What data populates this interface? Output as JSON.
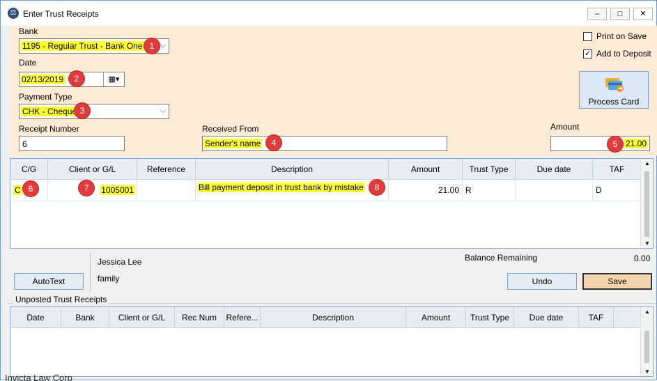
{
  "window": {
    "title": "Enter Trust Receipts",
    "minimize": "–",
    "maximize": "□",
    "close": "✕"
  },
  "bank": {
    "label": "Bank",
    "value": "1195 - Regular Trust - Bank One"
  },
  "date": {
    "label": "Date",
    "value": "02/13/2019"
  },
  "payment_type": {
    "label": "Payment Type",
    "value": "CHK - Cheque"
  },
  "receipt_number": {
    "label": "Receipt Number",
    "value": "6"
  },
  "received_from": {
    "label": "Received From",
    "value": "Sender's name"
  },
  "amount": {
    "label": "Amount",
    "value": "21.00"
  },
  "options": {
    "print_on_save": {
      "label": "Print on Save",
      "checked": false
    },
    "add_to_deposit": {
      "label": "Add to Deposit",
      "checked": true
    }
  },
  "process_card": {
    "label": "Process Card"
  },
  "markers": [
    "1",
    "2",
    "3",
    "4",
    "5",
    "6",
    "7",
    "8"
  ],
  "entry_grid": {
    "columns": [
      "C/G",
      "Client or G/L",
      "Reference",
      "Description",
      "Amount",
      "Trust Type",
      "Due date",
      "TAF"
    ],
    "rows": [
      {
        "cg": "C",
        "client": "1005001",
        "reference": "",
        "description": "Bill payment deposit in trust bank by mistake",
        "amount": "21.00",
        "trust_type": "R",
        "due_date": "",
        "taf": "D"
      }
    ]
  },
  "client_info": {
    "name": "Jessica Lee",
    "matter": "family"
  },
  "balance": {
    "label": "Balance Remaining",
    "value": "0.00"
  },
  "buttons": {
    "autotext": "AutoText",
    "undo": "Undo",
    "save": "Save"
  },
  "unposted": {
    "title": "Unposted Trust Receipts",
    "columns": [
      "Date",
      "Bank",
      "Client or G/L",
      "Rec Num",
      "Refere...",
      "Description",
      "Amount",
      "Trust Type",
      "Due date",
      "TAF"
    ]
  },
  "footer_text": "Invicta Law Corp"
}
